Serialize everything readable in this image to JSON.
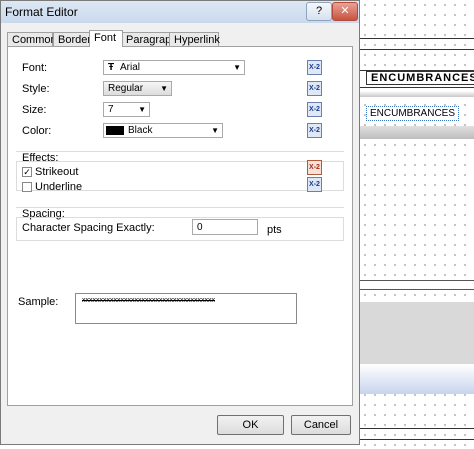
{
  "dialog": {
    "title": "Format Editor",
    "help_glyph": "?",
    "close_glyph": "✕",
    "tabs": [
      "Common",
      "Border",
      "Font",
      "Paragraph",
      "Hyperlink"
    ],
    "active_tab": "Font",
    "font": {
      "font_label": "Font:",
      "font_value": "Arial",
      "style_label": "Style:",
      "style_value": "Regular",
      "size_label": "Size:",
      "size_value": "7",
      "color_label": "Color:",
      "color_value": "Black",
      "color_swatch": "#000000",
      "formula_glyph": "X-2"
    },
    "effects": {
      "title": "Effects:",
      "strikeout_label": "Strikeout",
      "strikeout_checked": true,
      "underline_label": "Underline",
      "underline_checked": false
    },
    "spacing": {
      "title": "Spacing:",
      "char_spacing_label": "Character Spacing Exactly:",
      "char_spacing_value": "0",
      "unit": "pts"
    },
    "sample": {
      "label": "Sample:",
      "text": "xxxxxxxxxxxxxxxxxxxxxxxxxxxxxxxxxxxxxx"
    },
    "ok_label": "OK",
    "cancel_label": "Cancel"
  },
  "background": {
    "enc_header": "ENCUMBRANCES",
    "enc_field": "ENCUMBRANCES"
  }
}
